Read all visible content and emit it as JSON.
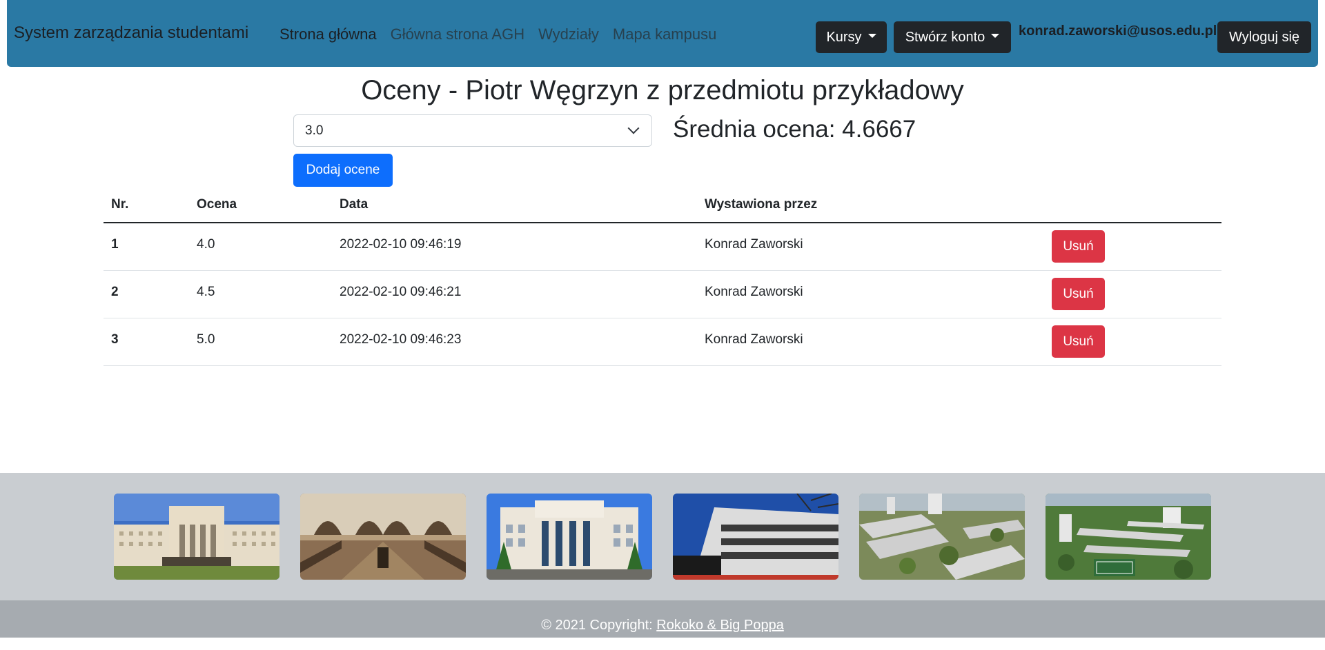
{
  "navbar": {
    "brand": "System zarządzania studentami",
    "links": [
      "Strona główna",
      "Główna strona AGH",
      "Wydziały",
      "Mapa kampusu"
    ],
    "courses_label": "Kursy",
    "create_account_label": "Stwórz konto",
    "user_email": "konrad.zaworski@usos.edu.pl",
    "logout_label": "Wyloguj się"
  },
  "main": {
    "title": "Oceny - Piotr Węgrzyn z przedmiotu przykładowy",
    "selected_grade": "3.0",
    "average": "Średnia ocena: 4.6667",
    "add_label": "Dodaj ocene"
  },
  "table": {
    "headers": [
      "Nr.",
      "Ocena",
      "Data",
      "Wystawiona przez"
    ],
    "rows": [
      {
        "nr": "1",
        "grade": "4.0",
        "date": "2022-02-10 09:46:19",
        "by": "Konrad Zaworski",
        "action": "Usuń"
      },
      {
        "nr": "2",
        "grade": "4.5",
        "date": "2022-02-10 09:46:21",
        "by": "Konrad Zaworski",
        "action": "Usuń"
      },
      {
        "nr": "3",
        "grade": "5.0",
        "date": "2022-02-10 09:46:23",
        "by": "Konrad Zaworski",
        "action": "Usuń"
      }
    ]
  },
  "footer": {
    "copyright_prefix": "© 2021 Copyright: ",
    "copyright_link": "Rokoko & Big Poppa"
  },
  "colors": {
    "navbar": "#2a79a4",
    "primary": "#0d6efd",
    "danger": "#dc3545",
    "dark": "#212529",
    "gallery_bg": "#c9cdd1",
    "footer_bg": "#a6abb0"
  }
}
